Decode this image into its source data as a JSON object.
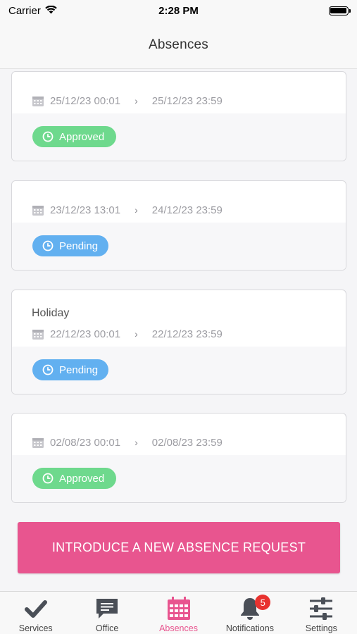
{
  "status_bar": {
    "carrier": "Carrier",
    "time": "2:28 PM"
  },
  "nav": {
    "title": "Absences"
  },
  "absences": [
    {
      "type": "",
      "start": "25/12/23 00:01",
      "end": "25/12/23 23:59",
      "status": "Approved"
    },
    {
      "type": "",
      "start": "23/12/23 13:01",
      "end": "24/12/23 23:59",
      "status": "Pending"
    },
    {
      "type": "Holiday",
      "start": "22/12/23 00:01",
      "end": "22/12/23 23:59",
      "status": "Pending"
    },
    {
      "type": "",
      "start": "02/08/23 00:01",
      "end": "02/08/23 23:59",
      "status": "Approved"
    }
  ],
  "action": {
    "new_request_label": "INTRODUCE A NEW ABSENCE REQUEST"
  },
  "tabs": [
    {
      "label": "Services",
      "icon": "check-icon"
    },
    {
      "label": "Office",
      "icon": "chat-icon"
    },
    {
      "label": "Absences",
      "icon": "calendar-icon"
    },
    {
      "label": "Notifications",
      "icon": "bell-icon",
      "badge": "5"
    },
    {
      "label": "Settings",
      "icon": "sliders-icon"
    }
  ],
  "colors": {
    "accent": "#e8558f",
    "approved": "#6ed98d",
    "pending": "#62b0f0",
    "badge": "#e8322f"
  }
}
